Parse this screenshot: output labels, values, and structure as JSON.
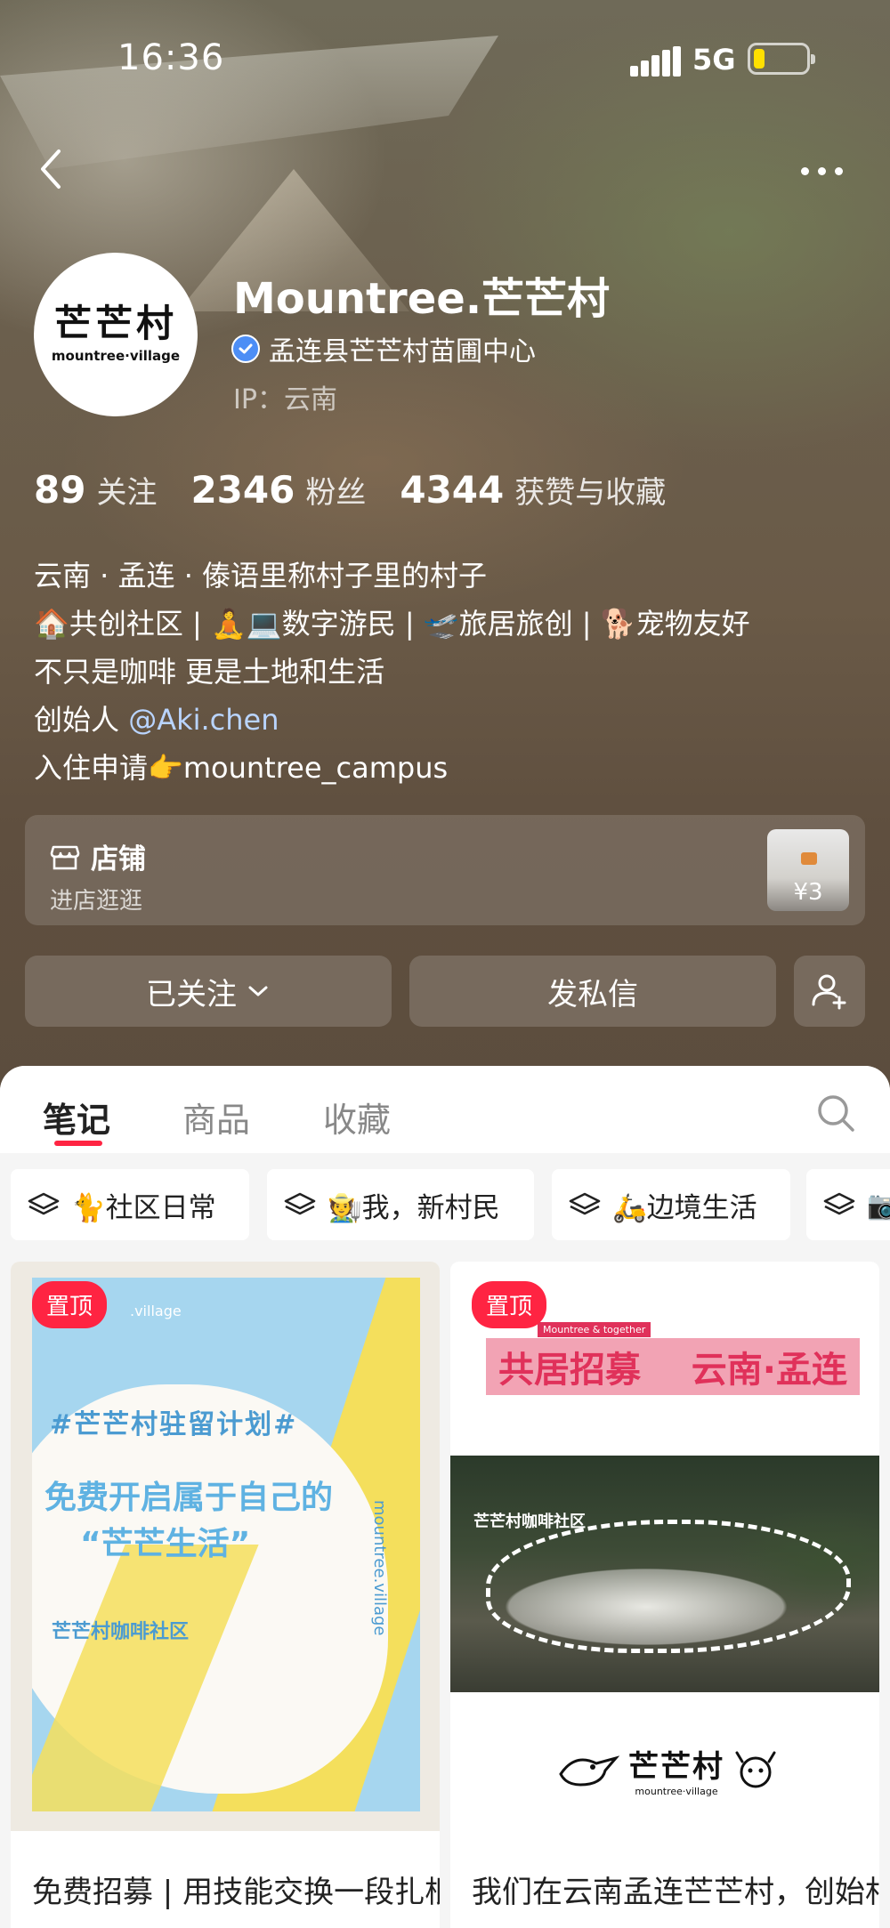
{
  "status_bar": {
    "time": "16:36",
    "network": "5G"
  },
  "profile": {
    "avatar_logo_cn": "芒芒村",
    "avatar_logo_en": "mountree·village",
    "nickname": "Mountree.芒芒村",
    "verified_org": "孟连县芒芒村苗圃中心",
    "ip": "IP：云南"
  },
  "stats": [
    {
      "num": "89",
      "label": "关注"
    },
    {
      "num": "2346",
      "label": "粉丝"
    },
    {
      "num": "4344",
      "label": "获赞与收藏"
    }
  ],
  "bio": {
    "line1": "云南 · 孟连 · 傣语里称村子里的村子",
    "line2": "🏠共创社区 | 🧘💻数字游民 | 🛫旅居旅创 | 🐕宠物友好",
    "line3": "不只是咖啡 更是土地和生活",
    "line4_prefix": "创始人 ",
    "line4_mention": "@Aki.chen",
    "line5": "入住申请👉mountree_campus"
  },
  "shop": {
    "title": "店铺",
    "subtitle": "进店逛逛",
    "price": "¥3"
  },
  "actions": {
    "follow": "已关注",
    "message": "发私信"
  },
  "tabs": [
    {
      "label": "笔记",
      "active": true
    },
    {
      "label": "商品",
      "active": false
    },
    {
      "label": "收藏",
      "active": false
    }
  ],
  "collections": [
    {
      "label": "🐈社区日常"
    },
    {
      "label": "🧑‍🌾我，新村民"
    },
    {
      "label": "🛵边境生活"
    },
    {
      "label": "📷"
    }
  ],
  "notes": [
    {
      "pin": "置顶",
      "poster_tag": "#芒芒村驻留计划#",
      "poster_main_1": "免费开启属于自己的",
      "poster_main_2": "“芒芒生活”",
      "poster_sub": "芒芒村咖啡社区",
      "poster_vertical": "mountree.village",
      "poster_top": ".village",
      "title": "免费招募 | 用技能交换一段扎根的生活"
    },
    {
      "pin": "置顶",
      "poster_small": "Mountree & together",
      "poster_title_left": "共居招募",
      "poster_title_right": "云南·孟连",
      "photo_label": "芒芒村咖啡社区",
      "logo_cn": "芒芒村",
      "logo_en": "mountree·village",
      "title": "我们在云南孟连芒芒村，创始村民开启招募啦"
    }
  ],
  "colors": {
    "accent": "#ff2442",
    "mention": "#b9d4ff",
    "verified": "#4d8ef5"
  }
}
